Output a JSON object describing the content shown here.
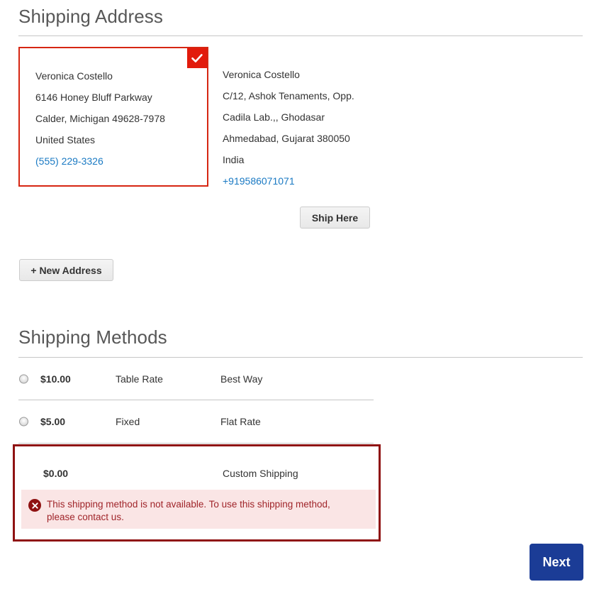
{
  "shipping_address": {
    "title": "Shipping Address",
    "cards": [
      {
        "selected": true,
        "name": "Veronica Costello",
        "street": "6146 Honey Bluff Parkway",
        "city_region": "Calder, Michigan 49628-7978",
        "country": "United States",
        "phone": "(555) 229-3326"
      },
      {
        "selected": false,
        "name": "Veronica Costello",
        "street": "C/12, Ashok Tenaments, Opp.",
        "street2": "Cadila Lab.,, Ghodasar",
        "city_region": "Ahmedabad, Gujarat 380050",
        "country": "India",
        "phone": "+919586071071"
      }
    ],
    "ship_here_label": "Ship Here",
    "new_address_label": "+ New Address"
  },
  "shipping_methods": {
    "title": "Shipping Methods",
    "rows": [
      {
        "price": "$10.00",
        "carrier": "Table Rate",
        "method": "Best Way",
        "selected": false,
        "available": true
      },
      {
        "price": "$5.00",
        "carrier": "Fixed",
        "method": "Flat Rate",
        "selected": false,
        "available": true
      },
      {
        "price": "$0.00",
        "carrier": "",
        "method": "Custom Shipping",
        "selected": false,
        "available": false,
        "error_message": "This shipping method is not available. To use this shipping method, please contact us."
      }
    ]
  },
  "footer": {
    "next_label": "Next"
  },
  "colors": {
    "selected_border": "#d62612",
    "badge": "#e21b0c",
    "error_border": "#8f1212",
    "error_background": "#fae5e5",
    "error_text": "#a0252a",
    "link": "#1979c3",
    "primary_button": "#1b3c96",
    "heading": "#575757",
    "rule": "#c6c6c6"
  }
}
